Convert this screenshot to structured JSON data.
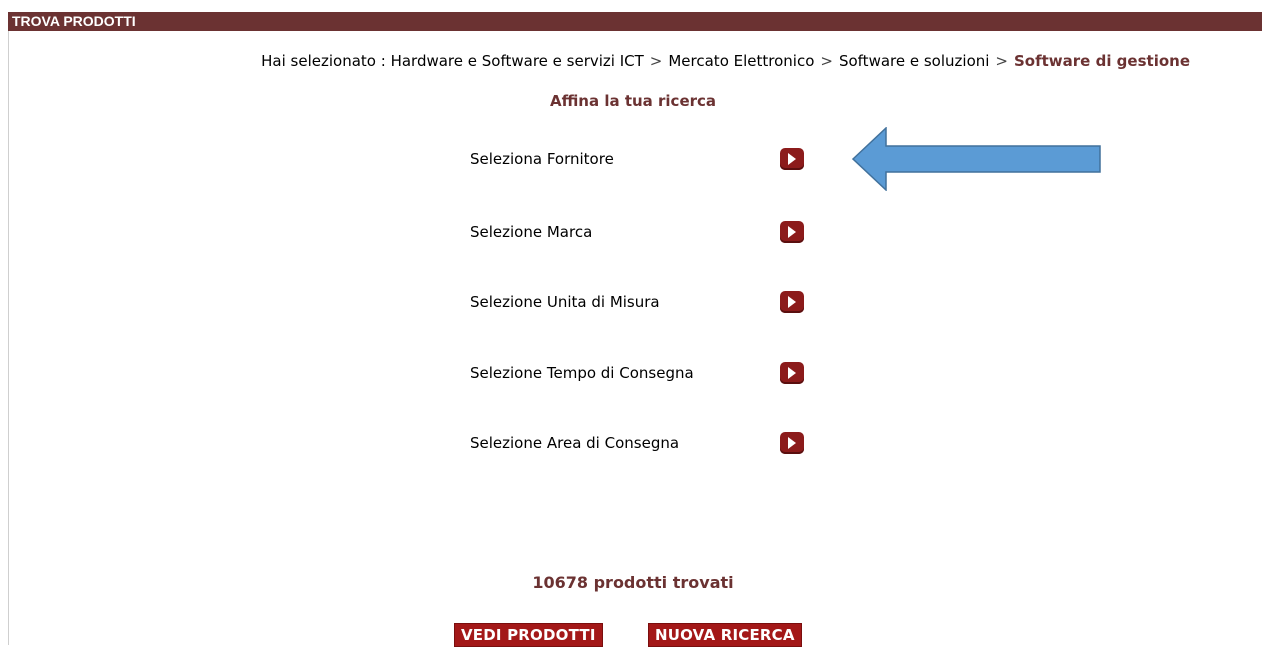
{
  "header": {
    "title": "TROVA PRODOTTI"
  },
  "breadcrumb": {
    "prefix": "Hai selezionato :",
    "items": [
      "Hardware e Software e servizi ICT",
      "Mercato Elettronico",
      "Software e soluzioni"
    ],
    "separator": ">",
    "current": "Software di gestione"
  },
  "refine": {
    "title": "Affina la tua ricerca",
    "filters": [
      {
        "label": "Seleziona Fornitore",
        "icon": "play-arrow-icon"
      },
      {
        "label": "Selezione Marca",
        "icon": "play-arrow-icon"
      },
      {
        "label": "Selezione Unita di Misura",
        "icon": "play-arrow-icon"
      },
      {
        "label": "Selezione Tempo di Consegna",
        "icon": "play-arrow-icon"
      },
      {
        "label": "Selezione Area di Consegna",
        "icon": "play-arrow-icon"
      }
    ]
  },
  "annotation": {
    "icon": "left-arrow-callout",
    "color": "#5b9bd5"
  },
  "results": {
    "count_text": "10678 prodotti trovati"
  },
  "actions": {
    "view_label": "VEDI PRODOTTI",
    "new_search_label": "NUOVA RICERCA"
  },
  "colors": {
    "brand": "#6b3232",
    "button": "#a31818",
    "filter_button": "#8c1b1b"
  }
}
